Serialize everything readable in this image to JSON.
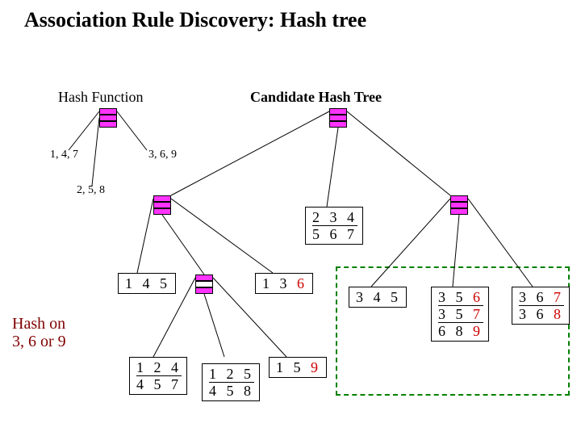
{
  "title": "Association Rule Discovery: Hash tree",
  "hash_function_label": "Hash Function",
  "candidate_tree_label": "Candidate Hash Tree",
  "branch_labels": {
    "left": "1, 4, 7",
    "right": "3, 6, 9",
    "mid": "2, 5, 8"
  },
  "hash_on_label": {
    "line1": "Hash on",
    "line2": "3, 6 or 9"
  },
  "leaves": {
    "n234_567": {
      "row1": "2 3 4",
      "row2": "5 6 7"
    },
    "n145": {
      "row1": "1 4 5"
    },
    "n136": {
      "row1_pre": "1 3",
      "row1_last": "6"
    },
    "n124_457": {
      "row1": "1 2 4",
      "row2": "4 5 7"
    },
    "n125_458": {
      "row1": "1 2 5",
      "row2": "4 5 8"
    },
    "n159": {
      "row1_pre": "1 5",
      "row1_last": "9"
    },
    "n345": {
      "row1": "3 4 5"
    },
    "n356_357_689": {
      "row1_pre": "3 5",
      "row1_last": "6",
      "row2_pre": "3 5",
      "row2_last": "7",
      "row3_pre": "6 8",
      "row3_last": "9"
    },
    "n367_368": {
      "row1_pre": "3 6",
      "row1_last": "7",
      "row2_pre": "3 6",
      "row2_last": "8"
    }
  },
  "chart_data": {
    "type": "table",
    "tree": {
      "root": {
        "children": [
          {
            "hash": "1,4,7",
            "children": [
              {
                "hash": "1,4,7",
                "leaf": [
                  "1 4 5"
                ]
              },
              {
                "hash": "2,5,8",
                "children": [
                  {
                    "leaf": [
                      "1 2 4",
                      "4 5 7"
                    ]
                  },
                  {
                    "leaf": [
                      "1 2 5",
                      "4 5 8"
                    ]
                  },
                  {
                    "leaf": [
                      "1 5 9"
                    ]
                  }
                ]
              },
              {
                "hash": "3,6,9",
                "leaf": [
                  "1 3 6"
                ]
              }
            ]
          },
          {
            "hash": "2,5,8",
            "leaf": [
              "2 3 4",
              "5 6 7"
            ]
          },
          {
            "hash": "3,6,9",
            "children": [
              {
                "leaf": [
                  "3 4 5"
                ]
              },
              {
                "leaf": [
                  "3 5 6",
                  "3 5 7",
                  "6 8 9"
                ]
              },
              {
                "leaf": [
                  "3 6 7",
                  "3 6 8"
                ]
              }
            ],
            "highlighted": true
          }
        ]
      }
    },
    "hash_function": {
      "1": "1,4,7",
      "2": "2,5,8",
      "0": "3,6,9"
    }
  }
}
